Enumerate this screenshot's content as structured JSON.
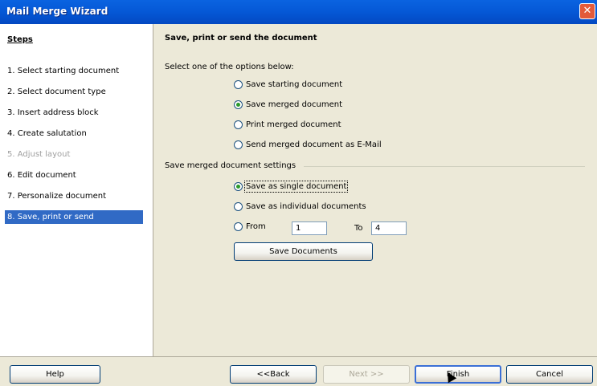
{
  "window": {
    "title": "Mail Merge Wizard",
    "close_glyph": "✕"
  },
  "steps": {
    "header": "Steps",
    "items": [
      {
        "label": "1.  Select starting document"
      },
      {
        "label": "2.  Select document type"
      },
      {
        "label": "3.  Insert address block"
      },
      {
        "label": "4.  Create salutation"
      },
      {
        "label": "5.  Adjust layout"
      },
      {
        "label": "6.  Edit document"
      },
      {
        "label": "7.  Personalize document"
      },
      {
        "label": "8.  Save, print or send"
      }
    ]
  },
  "content": {
    "title": "Save, print or send the document",
    "instruction": "Select one of the options below:",
    "options": [
      {
        "label": "Save starting document",
        "checked": false
      },
      {
        "label": "Save merged document",
        "checked": true
      },
      {
        "label": "Print merged document",
        "checked": false
      },
      {
        "label": "Send merged document as E-Mail",
        "checked": false
      }
    ],
    "settings": {
      "group_label": "Save merged document settings",
      "single_label": "Save as single document",
      "individual_label": "Save as individual documents",
      "from_label": "From",
      "from_value": "1",
      "to_label": "To",
      "to_value": "4",
      "save_documents_label": "Save Documents"
    }
  },
  "footer": {
    "help": "Help",
    "back": "<<Back",
    "next": "Next >>",
    "finish": "Finish",
    "cancel": "Cancel"
  },
  "colors": {
    "titlebar": "#0558d6",
    "selection": "#316ac5",
    "radio_checked": "#2b9a2b"
  }
}
